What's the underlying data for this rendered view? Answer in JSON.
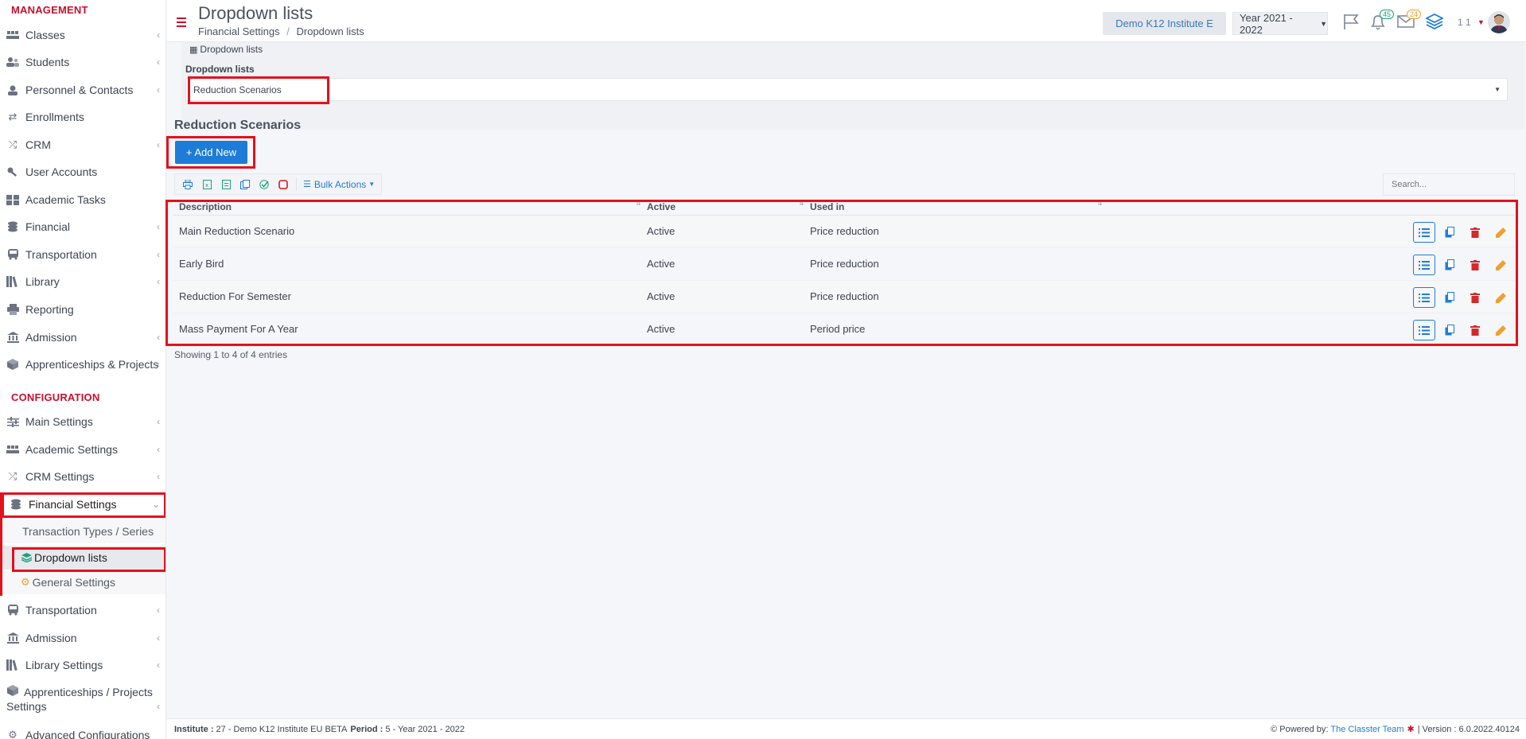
{
  "header": {
    "title": "Dropdown lists",
    "breadcrumb": [
      "Financial Settings",
      "Dropdown lists"
    ],
    "institute": "Demo K12 Institute E",
    "year": "Year 2021 - 2022",
    "notifications_count": "45",
    "messages_count": "24",
    "user_label": "1 1"
  },
  "sidebar": {
    "management_title": "MANAGEMENT",
    "management_items": [
      {
        "label": "Classes",
        "icon": "classes-icon"
      },
      {
        "label": "Students",
        "icon": "students-icon"
      },
      {
        "label": "Personnel & Contacts",
        "icon": "personnel-icon"
      },
      {
        "label": "Enrollments",
        "icon": "enrollments-icon"
      },
      {
        "label": "CRM",
        "icon": "crm-icon"
      },
      {
        "label": "User Accounts",
        "icon": "key-icon"
      },
      {
        "label": "Academic Tasks",
        "icon": "tasks-icon"
      },
      {
        "label": "Financial",
        "icon": "coins-icon"
      },
      {
        "label": "Transportation",
        "icon": "bus-icon"
      },
      {
        "label": "Library",
        "icon": "library-icon"
      },
      {
        "label": "Reporting",
        "icon": "print-icon"
      },
      {
        "label": "Admission",
        "icon": "institution-icon"
      },
      {
        "label": "Apprenticeships & Projects",
        "icon": "cube-icon"
      }
    ],
    "config_title": "CONFIGURATION",
    "config_items": [
      {
        "label": "Main Settings",
        "icon": "sliders-icon"
      },
      {
        "label": "Academic Settings",
        "icon": "classes-icon"
      },
      {
        "label": "CRM Settings",
        "icon": "crm-icon"
      },
      {
        "label": "Financial Settings",
        "icon": "coins-icon"
      }
    ],
    "financial_sub": [
      "Transaction Types / Series",
      "Dropdown lists",
      "General Settings"
    ],
    "config_items_after": [
      {
        "label": "Transportation",
        "icon": "bus-icon"
      },
      {
        "label": "Admission",
        "icon": "institution-icon"
      },
      {
        "label": "Library Settings",
        "icon": "library-icon"
      },
      {
        "label": "Apprenticeships / Projects Settings",
        "icon": "cube-icon"
      },
      {
        "label": "Advanced Configurations",
        "icon": "gears-icon"
      }
    ]
  },
  "main": {
    "panel_tab": "Dropdown lists",
    "select_label": "Dropdown lists",
    "select_value": "Reduction Scenarios",
    "section_title": "Reduction Scenarios",
    "add_button": "+ Add New",
    "bulk_actions": "Bulk Actions",
    "search_placeholder": "Search...",
    "columns": [
      "Description",
      "Active",
      "Used in"
    ],
    "rows": [
      {
        "description": "Main Reduction Scenario",
        "active": "Active",
        "used_in": "Price reduction"
      },
      {
        "description": "Early Bird",
        "active": "Active",
        "used_in": "Price reduction"
      },
      {
        "description": "Reduction For Semester",
        "active": "Active",
        "used_in": "Price reduction"
      },
      {
        "description": "Mass Payment For A Year",
        "active": "Active",
        "used_in": "Period price"
      }
    ],
    "showing": "Showing 1 to 4 of 4 entries"
  },
  "footer": {
    "institute_label": "Institute :",
    "institute_value": "27 - Demo K12 Institute EU BETA",
    "period_label": "Period :",
    "period_value": "5 - Year 2021 - 2022",
    "powered_label": "Powered by:",
    "powered_value": "The Classter Team",
    "version": "| Version : 6.0.2022.40124"
  },
  "colors": {
    "accent_red": "#e4101c",
    "brand_red": "#c8102e",
    "primary_blue": "#1d7cd8",
    "active_green": "#1aa37a"
  }
}
